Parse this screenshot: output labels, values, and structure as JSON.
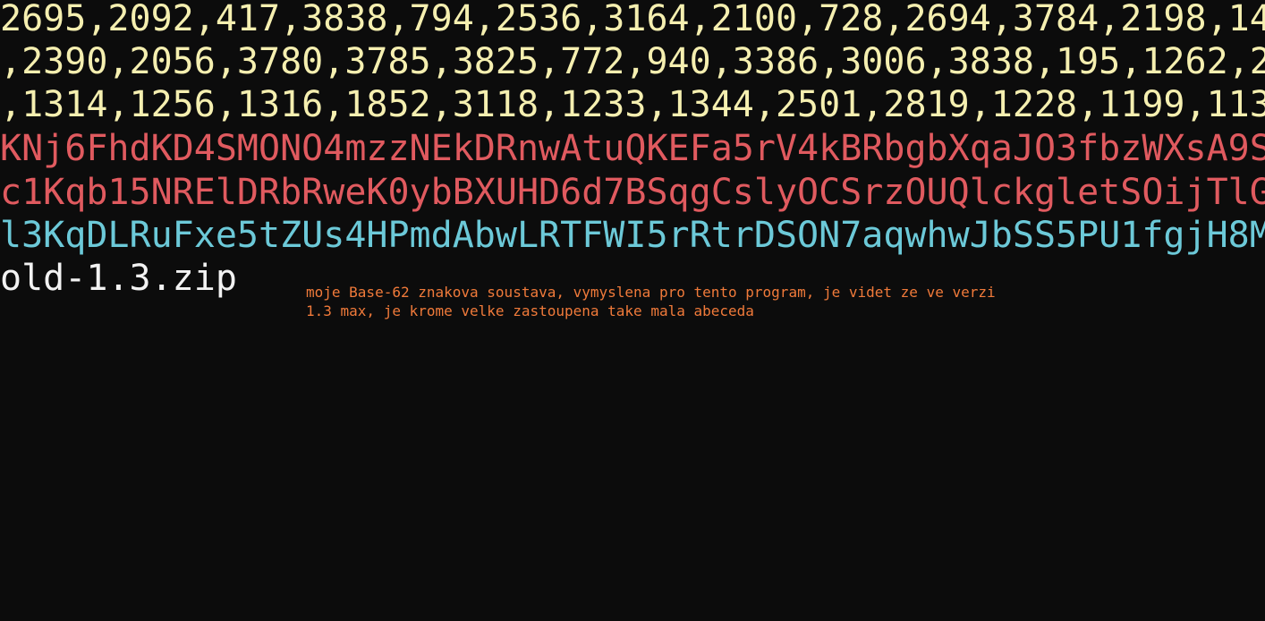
{
  "terminal": {
    "lines": [
      "2695,2092,417,3838,794,2536,3164,2100,728,2694,3784,2198,14",
      ",2390,2056,3780,3785,3825,772,940,3386,3006,3838,195,1262,2",
      ",1314,1256,1316,1852,3118,1233,1344,2501,2819,1228,1199,113",
      "KNj6FhdKD4SMONO4mzzNEkDRnwAtuQKEFa5rV4kBRbgbXqaJO3fbzWXsA9S",
      "c1Kqb15NRElDRbRweK0ybBXUHD6d7BSqgCslyOCSrzOUQlckgletSOijTlG",
      "l3KqDLRuFxe5tZUs4HPmdAbwLRTFWI5rRtrDSON7aqwhwJbSS5PU1fgjH8M",
      "old-1.3.zip"
    ],
    "annotation": "moje Base-62 znakova soustava, vymyslena pro tento program, je videt ze ve verzi\n1.3 max, je krome velke zastoupena take mala abeceda"
  },
  "colors": {
    "background": "#0c0c0c",
    "numbers": "#f5efb0",
    "encoded_red": "#e05a5f",
    "encoded_cyan": "#6cc9d8",
    "filename": "#f2f2f2",
    "annotation": "#f07a3a"
  }
}
